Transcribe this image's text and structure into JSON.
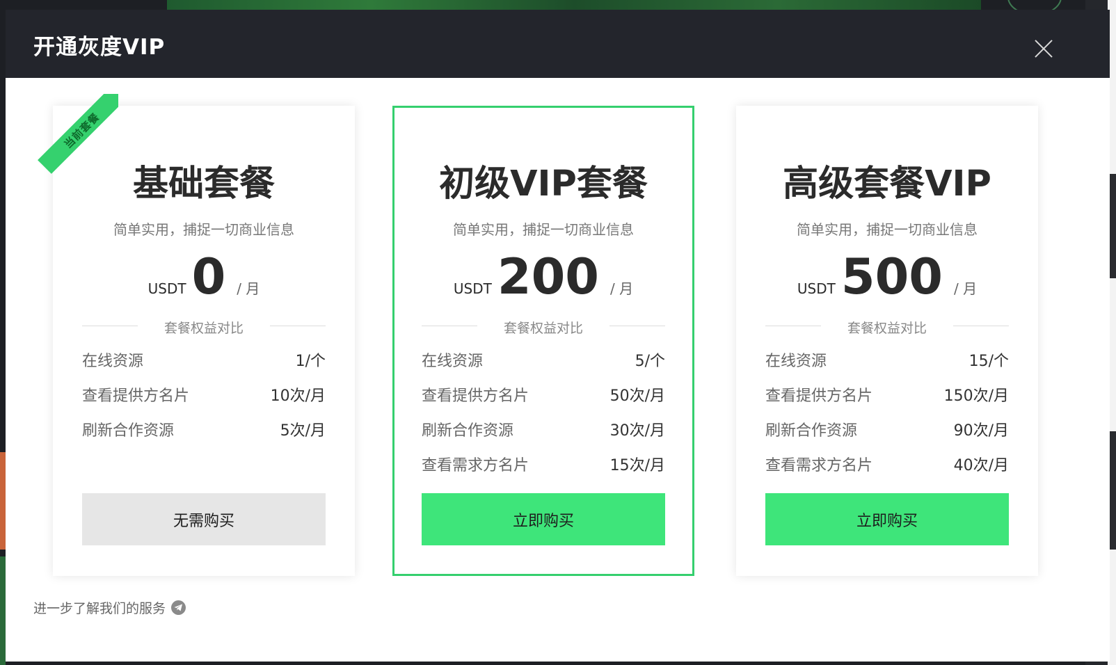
{
  "modal": {
    "title": "开通灰度VIP",
    "footer_link": "进一步了解我们的服务"
  },
  "plans": [
    {
      "name": "基础套餐",
      "description": "简单实用，捕捉一切商业信息",
      "currency": "USDT",
      "price": "0",
      "period": "/ 月",
      "section_title": "套餐权益对比",
      "ribbon": "当前套餐",
      "benefits": [
        {
          "label": "在线资源",
          "value": "1/个"
        },
        {
          "label": "查看提供方名片",
          "value": "10次/月"
        },
        {
          "label": "刷新合作资源",
          "value": "5次/月"
        }
      ],
      "button": "无需购买"
    },
    {
      "name": "初级VIP套餐",
      "description": "简单实用，捕捉一切商业信息",
      "currency": "USDT",
      "price": "200",
      "period": "/ 月",
      "section_title": "套餐权益对比",
      "benefits": [
        {
          "label": "在线资源",
          "value": "5/个"
        },
        {
          "label": "查看提供方名片",
          "value": "50次/月"
        },
        {
          "label": "刷新合作资源",
          "value": "30次/月"
        },
        {
          "label": "查看需求方名片",
          "value": "15次/月"
        }
      ],
      "button": "立即购买"
    },
    {
      "name": "高级套餐VIP",
      "description": "简单实用，捕捉一切商业信息",
      "currency": "USDT",
      "price": "500",
      "period": "/ 月",
      "section_title": "套餐权益对比",
      "benefits": [
        {
          "label": "在线资源",
          "value": "15/个"
        },
        {
          "label": "查看提供方名片",
          "value": "150次/月"
        },
        {
          "label": "刷新合作资源",
          "value": "90次/月"
        },
        {
          "label": "查看需求方名片",
          "value": "40次/月"
        }
      ],
      "button": "立即购买"
    }
  ],
  "colors": {
    "accent": "#3ee57a",
    "highlight_border": "#35cf6e",
    "header_bg": "#23252c"
  },
  "icons": {
    "close": "close-icon",
    "footer": "telegram-icon"
  }
}
